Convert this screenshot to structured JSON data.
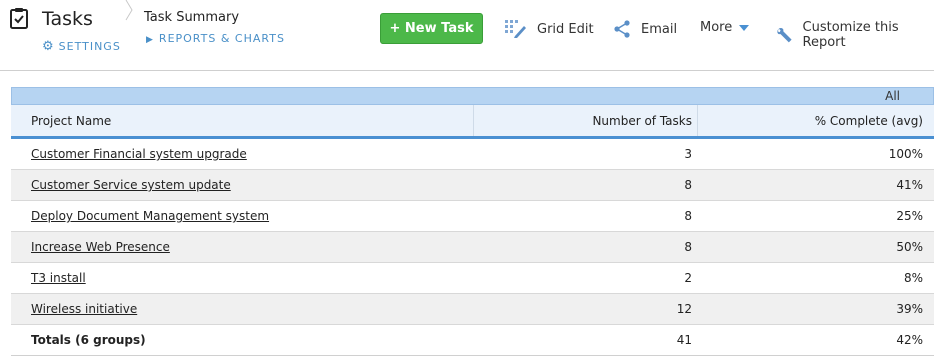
{
  "app": {
    "title": "Tasks",
    "settings_label": "SETTINGS"
  },
  "breadcrumb": {
    "title": "Task Summary",
    "link_label": "REPORTS & CHARTS"
  },
  "toolbar": {
    "new_task_label": "+ New Task",
    "grid_edit_label": "Grid Edit",
    "email_label": "Email",
    "more_label": "More",
    "customize_label": "Customize this Report"
  },
  "table": {
    "group_label": "All",
    "headers": {
      "project": "Project Name",
      "tasks": "Number of Tasks",
      "complete": "% Complete (avg)"
    },
    "rows": [
      {
        "project": "Customer Financial system upgrade",
        "tasks": "3",
        "complete": "100%"
      },
      {
        "project": "Customer Service system update",
        "tasks": "8",
        "complete": "41%"
      },
      {
        "project": "Deploy Document Management system",
        "tasks": "8",
        "complete": "25%"
      },
      {
        "project": "Increase Web Presence",
        "tasks": "8",
        "complete": "50%"
      },
      {
        "project": "T3 install",
        "tasks": "2",
        "complete": "8%"
      },
      {
        "project": "Wireless initiative",
        "tasks": "12",
        "complete": "39%"
      }
    ],
    "totals": {
      "label": "Totals (6 groups)",
      "tasks": "41",
      "complete": "42%"
    }
  },
  "colors": {
    "accent": "#4a90c8",
    "new_button": "#4cb849",
    "header_band": "#b6d4f2"
  },
  "icons": {
    "app": "clipboard-icon",
    "settings": "gear-icon",
    "grid_edit": "grid-edit-icon",
    "email": "share-icon",
    "more": "caret-down-icon",
    "customize": "wrench-icon"
  }
}
